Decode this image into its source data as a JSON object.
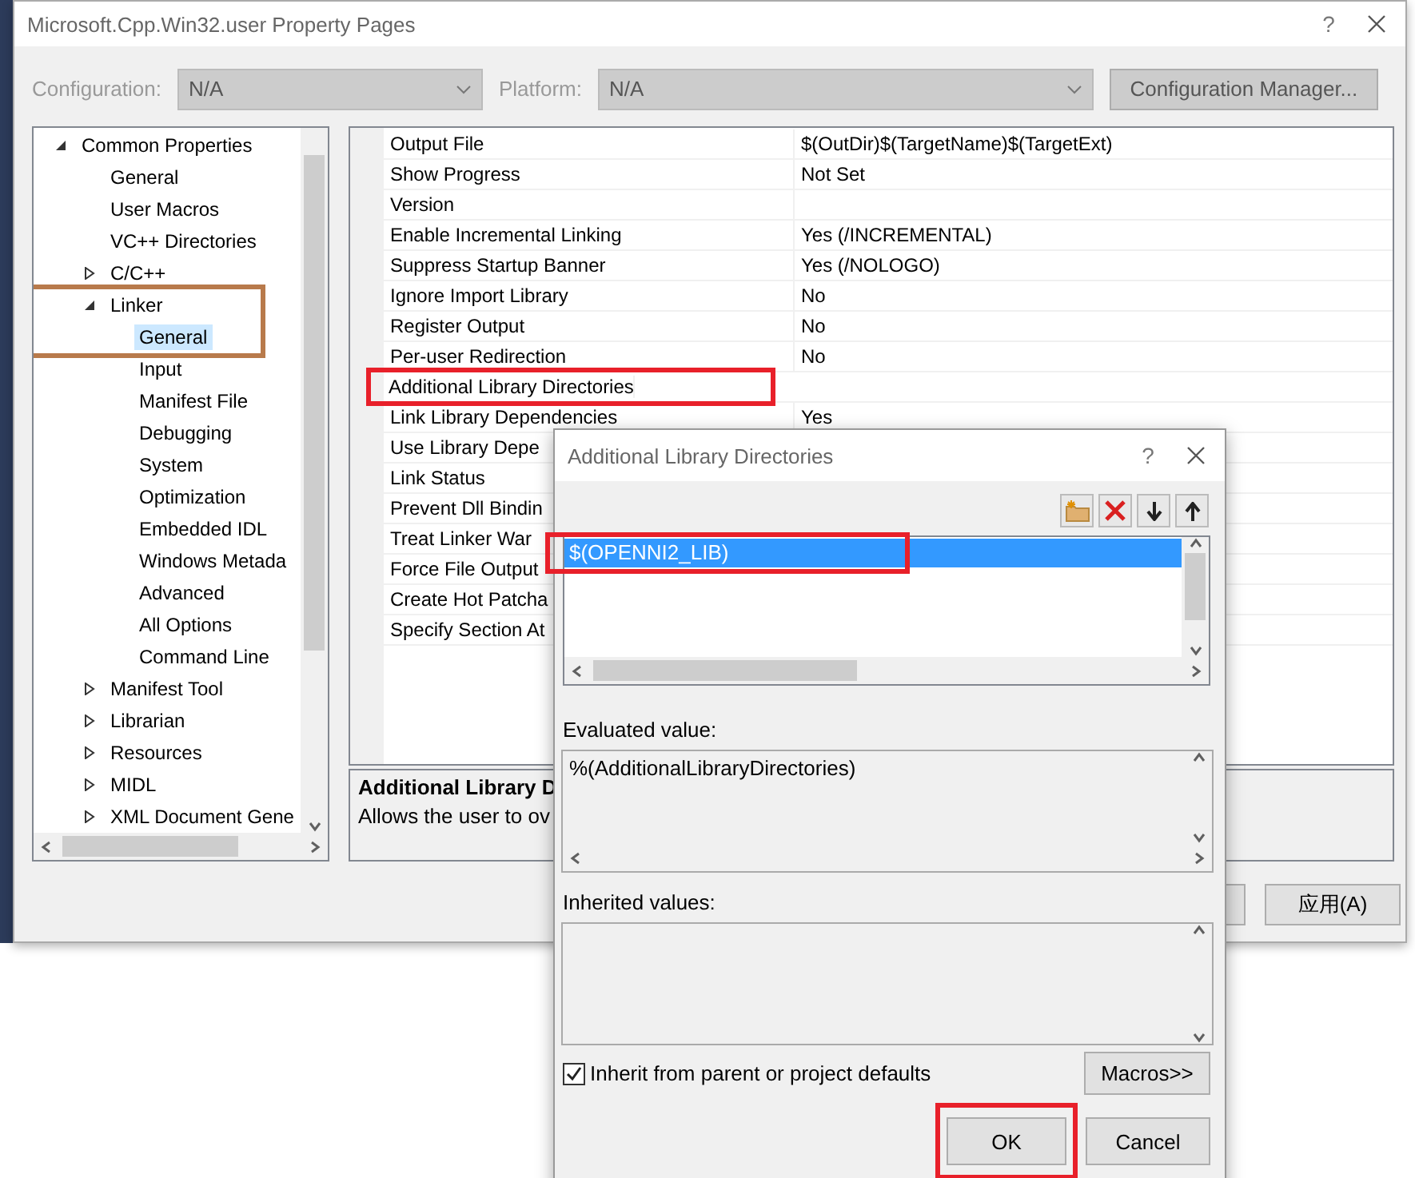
{
  "window": {
    "title": "Microsoft.Cpp.Win32.user Property Pages",
    "help": "?"
  },
  "configuration": {
    "label": "Configuration:",
    "value": "N/A",
    "disabled": true
  },
  "platform": {
    "label": "Platform:",
    "value": "N/A",
    "disabled": true
  },
  "configuration_manager": {
    "label": "Configuration Manager...",
    "disabled": true
  },
  "tree": [
    {
      "label": "Common Properties",
      "expanded": true,
      "selected": false,
      "highlighted": false,
      "children": [
        {
          "label": "General",
          "selected": false,
          "highlighted": false
        },
        {
          "label": "User Macros",
          "selected": false,
          "highlighted": false
        },
        {
          "label": "VC++ Directories",
          "selected": false,
          "highlighted": false
        },
        {
          "label": "C/C++",
          "expanded": false,
          "selected": false,
          "highlighted": false
        },
        {
          "label": "Linker",
          "expanded": true,
          "selected": false,
          "highlighted": true,
          "children": [
            {
              "label": "General",
              "selected": true,
              "highlighted": true
            },
            {
              "label": "Input",
              "selected": false,
              "highlighted": false
            },
            {
              "label": "Manifest File",
              "selected": false,
              "highlighted": false
            },
            {
              "label": "Debugging",
              "selected": false,
              "highlighted": false
            },
            {
              "label": "System",
              "selected": false,
              "highlighted": false
            },
            {
              "label": "Optimization",
              "selected": false,
              "highlighted": false
            },
            {
              "label": "Embedded IDL",
              "selected": false,
              "highlighted": false
            },
            {
              "label": "Windows Metada",
              "selected": false,
              "highlighted": false
            },
            {
              "label": "Advanced",
              "selected": false,
              "highlighted": false
            },
            {
              "label": "All Options",
              "selected": false,
              "highlighted": false
            },
            {
              "label": "Command Line",
              "selected": false,
              "highlighted": false
            }
          ]
        },
        {
          "label": "Manifest Tool",
          "expanded": false,
          "selected": false,
          "highlighted": false
        },
        {
          "label": "Librarian",
          "expanded": false,
          "selected": false,
          "highlighted": false
        },
        {
          "label": "Resources",
          "expanded": false,
          "selected": false,
          "highlighted": false
        },
        {
          "label": "MIDL",
          "expanded": false,
          "selected": false,
          "highlighted": false
        },
        {
          "label": "XML Document Gene",
          "expanded": false,
          "selected": false,
          "highlighted": false
        }
      ]
    }
  ],
  "grid": [
    {
      "name": "Output File",
      "value": "$(OutDir)$(TargetName)$(TargetExt)",
      "highlighted": false
    },
    {
      "name": "Show Progress",
      "value": "Not Set",
      "highlighted": false
    },
    {
      "name": "Version",
      "highlighted": false
    },
    {
      "name": "Enable Incremental Linking",
      "value": "Yes (/INCREMENTAL)",
      "highlighted": false
    },
    {
      "name": "Suppress Startup Banner",
      "value": "Yes (/NOLOGO)",
      "highlighted": false
    },
    {
      "name": "Ignore Import Library",
      "value": "No",
      "highlighted": false
    },
    {
      "name": "Register Output",
      "value": "No",
      "highlighted": false
    },
    {
      "name": "Per-user Redirection",
      "value": "No",
      "highlighted": false
    },
    {
      "name": "Additional Library Directories",
      "highlighted": true
    },
    {
      "name": "Link Library Dependencies",
      "value": "Yes",
      "highlighted": false
    },
    {
      "name": "Use Library Depe",
      "highlighted": false
    },
    {
      "name": "Link Status",
      "highlighted": false
    },
    {
      "name": "Prevent Dll Bindin",
      "highlighted": false
    },
    {
      "name": "Treat Linker War",
      "highlighted": false
    },
    {
      "name": "Force File Output",
      "highlighted": false
    },
    {
      "name": "Create Hot Patcha",
      "highlighted": false
    },
    {
      "name": "Specify Section At",
      "highlighted": false
    }
  ],
  "description": {
    "title": "Additional Library D",
    "text": "Allows the user to ov"
  },
  "apply_button": {
    "label": "应用(A)"
  },
  "popup": {
    "title": "Additional Library Directories",
    "help": "?",
    "toolbar": [
      {
        "kind": "new-folder"
      },
      {
        "kind": "delete"
      },
      {
        "kind": "move-down"
      },
      {
        "kind": "move-up"
      }
    ],
    "list": [
      {
        "text": "$(OPENNI2_LIB)",
        "selected": true,
        "highlighted": true
      }
    ],
    "evaluated": {
      "label": "Evaluated value:",
      "value": "%(AdditionalLibraryDirectories)"
    },
    "inherited": {
      "label": "Inherited values:"
    },
    "inherit_checkbox": {
      "label": "Inherit from parent or project defaults",
      "checked": true
    },
    "macros_button": {
      "label": "Macros>>"
    },
    "buttons": [
      {
        "label": "OK",
        "highlighted": true
      },
      {
        "label": "Cancel",
        "highlighted": false
      }
    ]
  }
}
